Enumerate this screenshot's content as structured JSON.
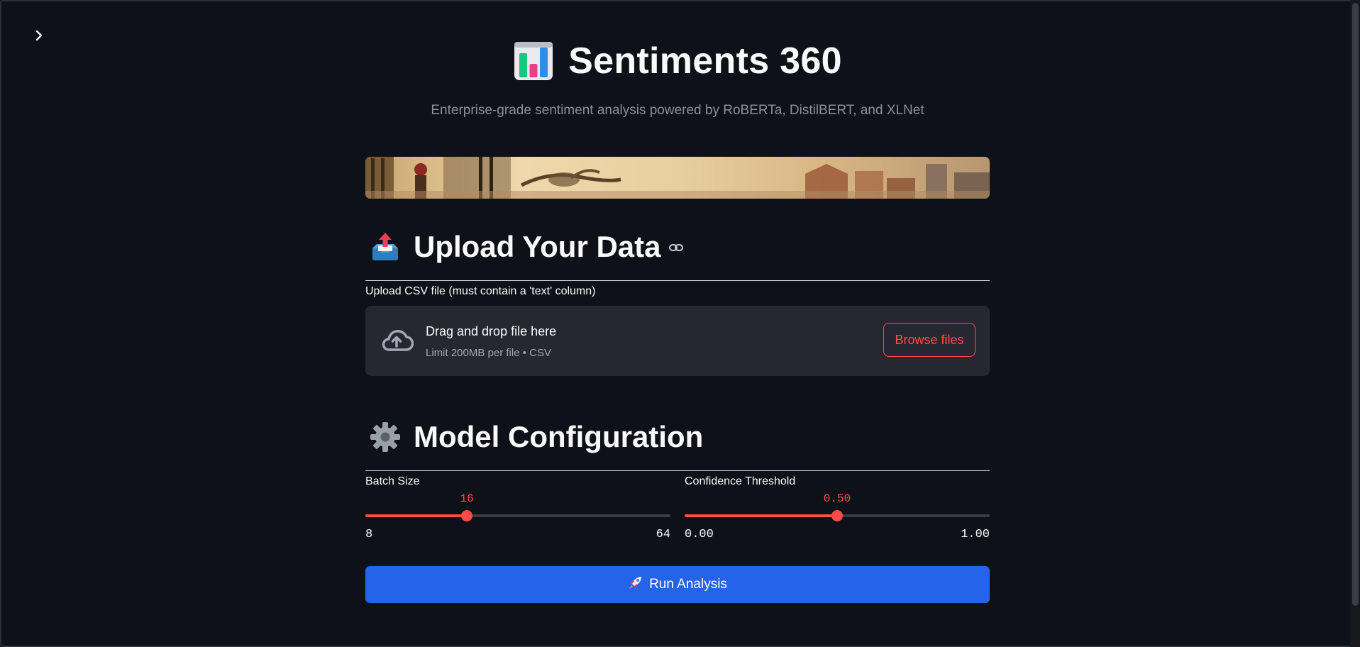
{
  "app": {
    "title": "Sentiments 360",
    "subtitle": "Enterprise-grade sentiment analysis powered by RoBERTa, DistilBERT, and XLNet"
  },
  "upload_section": {
    "heading": "Upload Your Data",
    "field_label": "Upload CSV file (must contain a 'text' column)",
    "dropzone_title": "Drag and drop file here",
    "dropzone_hint": "Limit 200MB per file • CSV",
    "browse_label": "Browse files"
  },
  "config_section": {
    "heading": "Model Configuration",
    "batch_size": {
      "label": "Batch Size",
      "value": "16",
      "min": "8",
      "max": "64"
    },
    "confidence_threshold": {
      "label": "Confidence Threshold",
      "value": "0.50",
      "min": "0.00",
      "max": "1.00"
    }
  },
  "run_button": {
    "label": "Run Analysis",
    "icon": "rocket-icon"
  },
  "icons": {
    "sidebar_toggle": "chevron-right-icon",
    "title": "bar-chart-icon",
    "upload": "outbox-tray-icon",
    "config": "gear-icon",
    "anchor": "link-icon",
    "dropzone": "cloud-upload-icon"
  },
  "colors": {
    "background": "#0e1117",
    "accent": "#ff4b4b",
    "primary_button": "#2563eb",
    "dropzone_bg": "#262730",
    "muted_text": "#8a8f99"
  }
}
